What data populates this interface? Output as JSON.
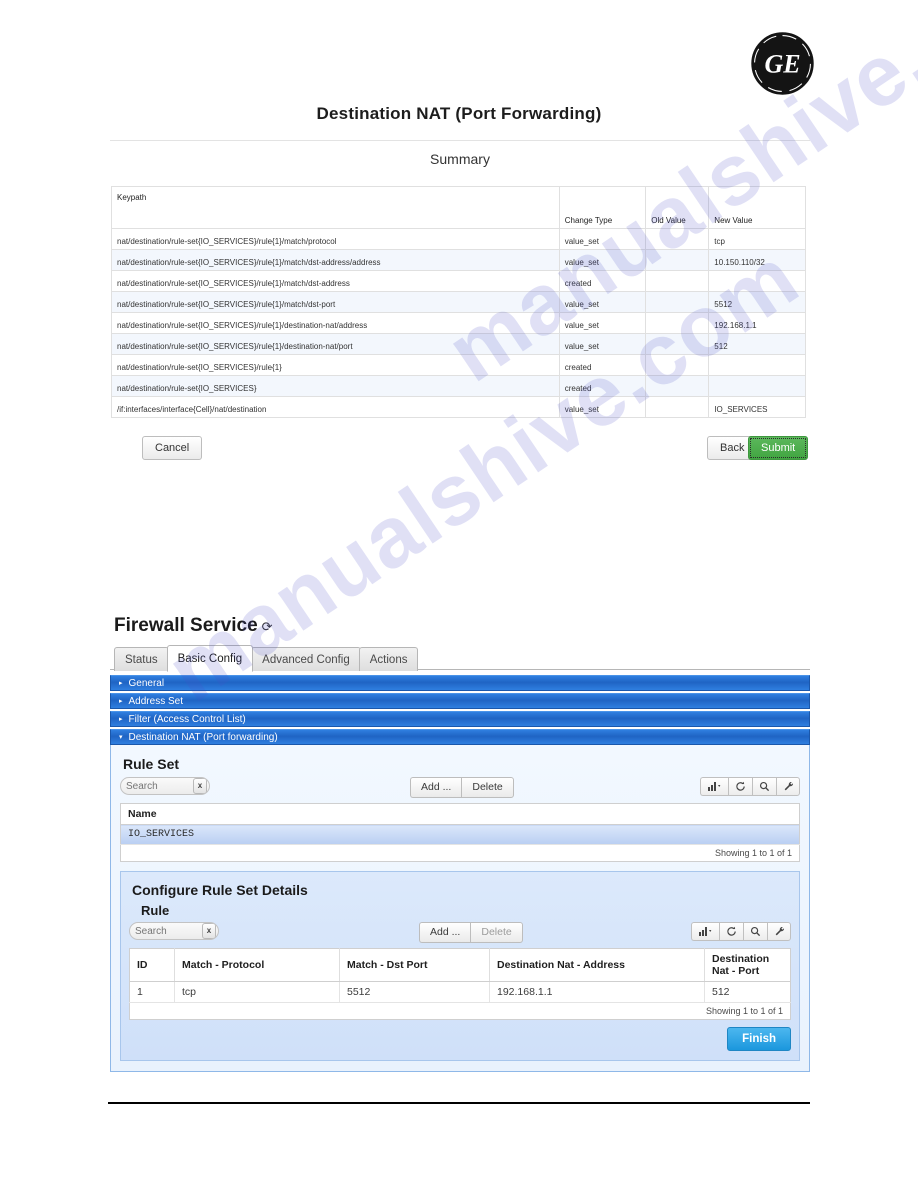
{
  "branding": {
    "logo_text": "GE",
    "logo_name": "ge-monogram-logo"
  },
  "watermark": {
    "text": "manualshive.com"
  },
  "page": {
    "title": "Destination NAT (Port Forwarding)",
    "summary_label": "Summary"
  },
  "summary_table": {
    "columns": [
      "Keypath",
      "Change Type",
      "Old Value",
      "New Value"
    ],
    "rows": [
      {
        "keypath": "nat/destination/rule-set{IO_SERVICES}/rule{1}/match/protocol",
        "change_type": "value_set",
        "old_value": "",
        "new_value": "tcp"
      },
      {
        "keypath": "nat/destination/rule-set{IO_SERVICES}/rule{1}/match/dst-address/address",
        "change_type": "value_set",
        "old_value": "",
        "new_value": "10.150.110/32"
      },
      {
        "keypath": "nat/destination/rule-set{IO_SERVICES}/rule{1}/match/dst-address",
        "change_type": "created",
        "old_value": "",
        "new_value": ""
      },
      {
        "keypath": "nat/destination/rule-set{IO_SERVICES}/rule{1}/match/dst-port",
        "change_type": "value_set",
        "old_value": "",
        "new_value": "5512"
      },
      {
        "keypath": "nat/destination/rule-set{IO_SERVICES}/rule{1}/destination-nat/address",
        "change_type": "value_set",
        "old_value": "",
        "new_value": "192.168.1.1"
      },
      {
        "keypath": "nat/destination/rule-set{IO_SERVICES}/rule{1}/destination-nat/port",
        "change_type": "value_set",
        "old_value": "",
        "new_value": "512"
      },
      {
        "keypath": "nat/destination/rule-set{IO_SERVICES}/rule{1}",
        "change_type": "created",
        "old_value": "",
        "new_value": ""
      },
      {
        "keypath": "nat/destination/rule-set{IO_SERVICES}",
        "change_type": "created",
        "old_value": "",
        "new_value": ""
      },
      {
        "keypath": "/if:interfaces/interface{Cell}/nat/destination",
        "change_type": "value_set",
        "old_value": "",
        "new_value": "IO_SERVICES"
      }
    ]
  },
  "wizard_buttons": {
    "cancel": "Cancel",
    "back": "Back",
    "submit": "Submit"
  },
  "firewall": {
    "heading": "Firewall Service",
    "refresh_glyph": "⟳",
    "tabs": [
      {
        "label": "Status",
        "active": false
      },
      {
        "label": "Basic Config",
        "active": true
      },
      {
        "label": "Advanced Config",
        "active": false
      },
      {
        "label": "Actions",
        "active": false
      }
    ],
    "accordions": [
      {
        "label": "General",
        "open": false,
        "marker": "▸"
      },
      {
        "label": "Address Set",
        "open": false,
        "marker": "▸"
      },
      {
        "label": "Filter (Access Control List)",
        "open": false,
        "marker": "▸"
      },
      {
        "label": "Destination NAT (Port forwarding)",
        "open": true,
        "marker": "▾"
      }
    ],
    "rule_set": {
      "heading": "Rule Set",
      "search_placeholder": "Search",
      "search_value": "",
      "clear_label": "x",
      "add_label": "Add ...",
      "delete_label": "Delete",
      "columns": [
        "Name"
      ],
      "rows": [
        {
          "name": "IO_SERVICES"
        }
      ],
      "footer": "Showing 1 to 1 of 1"
    },
    "rule_set_details": {
      "heading": "Configure Rule Set Details",
      "sub_heading": "Rule",
      "search_placeholder": "Search",
      "search_value": "",
      "clear_label": "x",
      "add_label": "Add ...",
      "delete_label": "Delete",
      "columns": [
        "ID",
        "Match - Protocol",
        "Match - Dst Port",
        "Destination Nat - Address",
        "Destination Nat - Port"
      ],
      "rows": [
        {
          "id": "1",
          "protocol": "tcp",
          "dst_port": "5512",
          "nat_address": "192.168.1.1",
          "nat_port": "512"
        }
      ],
      "footer": "Showing 1 to 1 of 1",
      "finish_label": "Finish"
    },
    "toolbar_icons": [
      {
        "name": "bar-chart-dropdown-icon"
      },
      {
        "name": "refresh-icon"
      },
      {
        "name": "search-icon"
      },
      {
        "name": "wrench-icon"
      }
    ]
  },
  "colors": {
    "accent_blue": "#1f64c4",
    "submit_green": "#41a541",
    "finish_blue": "#1b97dd",
    "selected_row": "#b9cef2"
  }
}
